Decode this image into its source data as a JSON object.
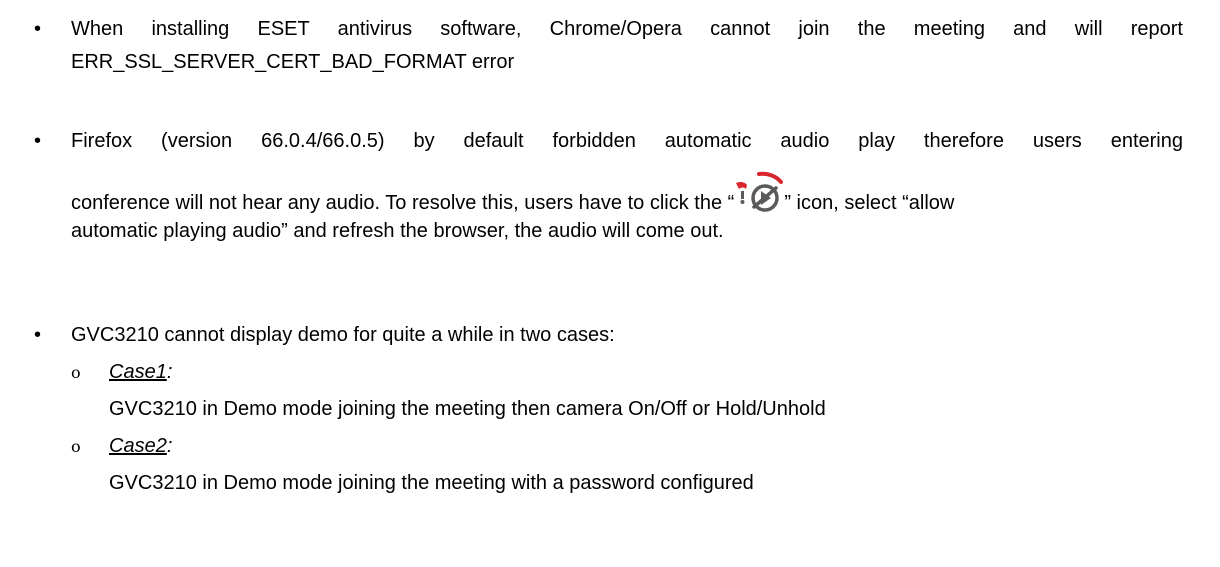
{
  "items": [
    {
      "line1": "When installing ESET antivirus software, Chrome/Opera cannot join the meeting and will report",
      "line2": "ERR_SSL_SERVER_CERT_BAD_FORMAT error"
    },
    {
      "line1": "Firefox (version 66.0.4/66.0.5) by default forbidden automatic audio play therefore users entering",
      "line2_before": "conference will not hear any audio. To resolve this, users have to click the “",
      "line2_after": "” icon, select “allow",
      "line3": "automatic playing audio” and refresh the browser, the audio will come out.",
      "icon": "autoplay-blocked-icon"
    },
    {
      "line1": "GVC3210 cannot display demo for quite a while in two cases:",
      "cases": [
        {
          "marker": "o",
          "label": "Case1",
          "colon": ":",
          "text": "GVC3210 in Demo mode joining the meeting then camera On/Off or Hold/Unhold"
        },
        {
          "marker": "o",
          "label": "Case2",
          "colon": ":",
          "text": "GVC3210 in Demo mode joining the meeting with a password configured"
        }
      ]
    }
  ],
  "bullet_glyph": "•",
  "colors": {
    "text": "#000000",
    "icon_red": "#d9262c",
    "icon_gray": "#5a5a5a"
  }
}
